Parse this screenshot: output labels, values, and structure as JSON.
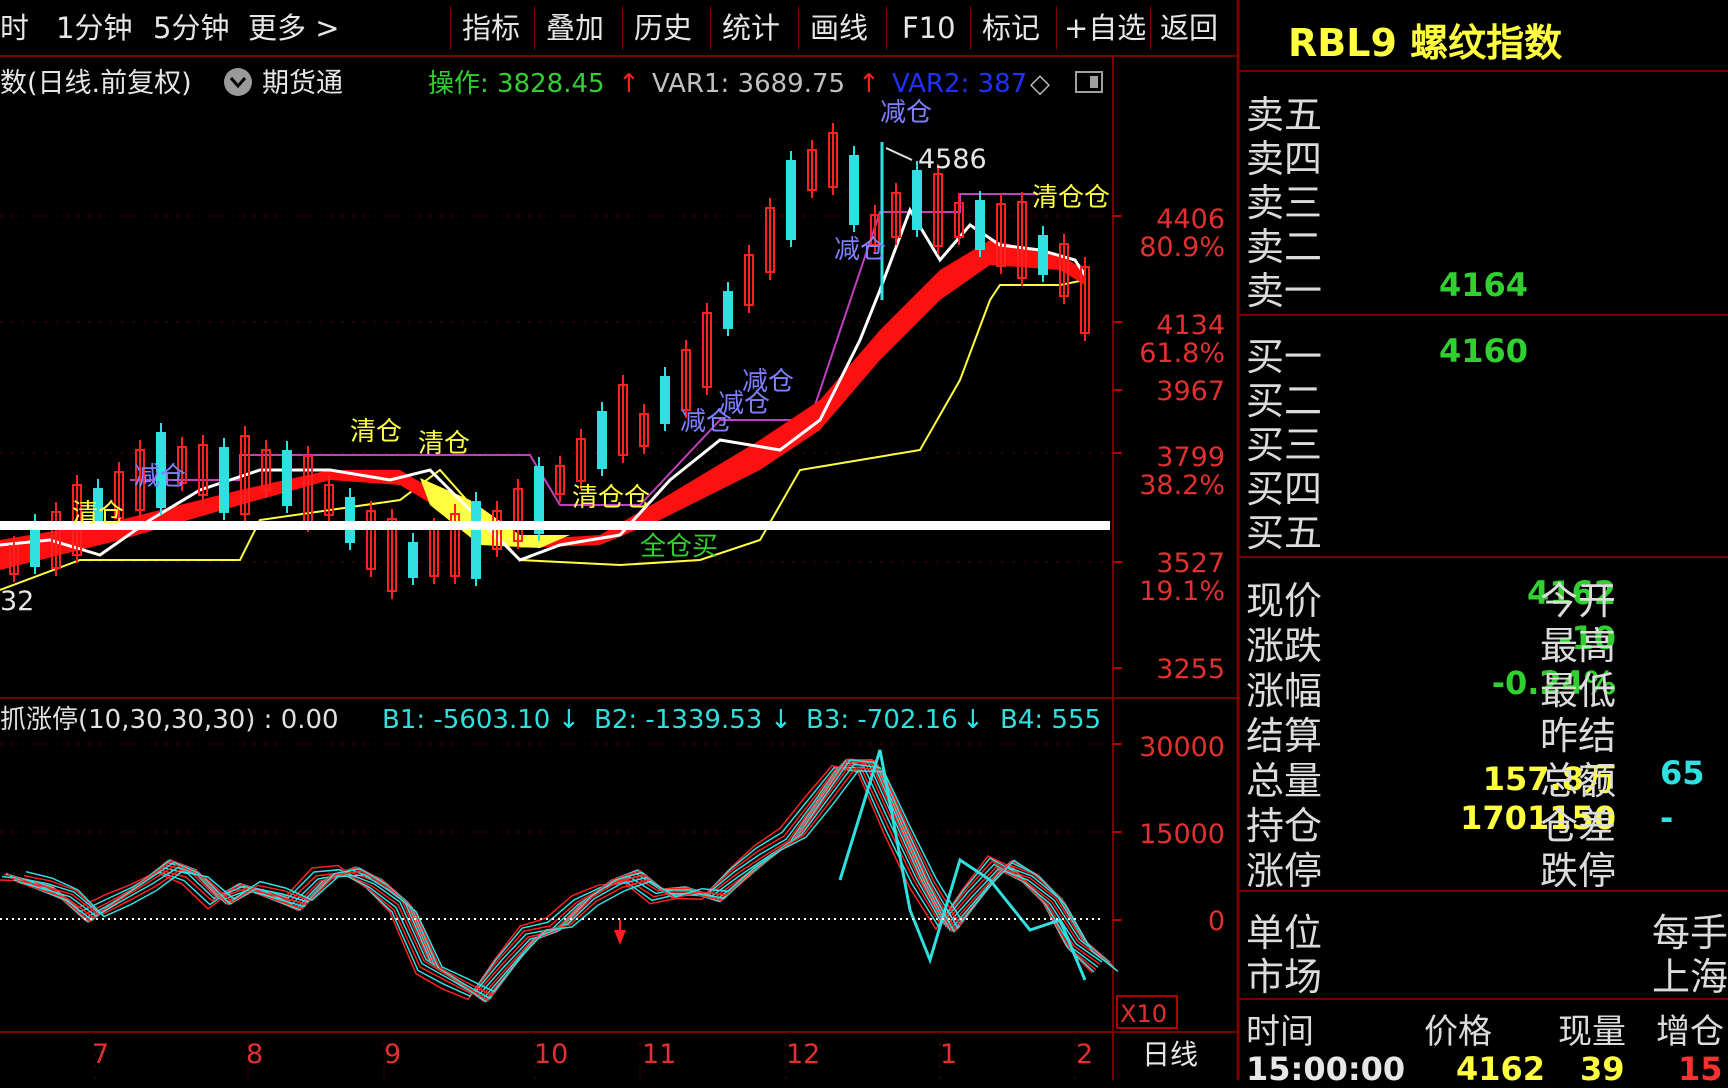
{
  "toolbar": {
    "left_items": [
      "时",
      "1分钟",
      "5分钟",
      "更多 >"
    ],
    "buttons": [
      "指标",
      "叠加",
      "历史",
      "统计",
      "画线",
      "F10",
      "标记",
      "+自选",
      "返回"
    ]
  },
  "main_header": {
    "title": "数(日线.前复权)",
    "futures_btn": "期货通",
    "op_label": "操作: 3828.45",
    "var1_label": "VAR1: 3689.75",
    "var2_label": "VAR2: 387",
    "arrow": "↑"
  },
  "price_axis": {
    "ticks": [
      "4406",
      "4134",
      "3967",
      "3799",
      "3527",
      "3255"
    ],
    "fib": [
      "80.9%",
      "61.8%",
      "38.2%",
      "19.1%"
    ]
  },
  "annotations": {
    "peak": "4586",
    "left_low": "32",
    "signals": [
      "清仓",
      "减仓",
      "清仓",
      "清仓",
      "清仓仓",
      "减仓",
      "减仓",
      "减仓",
      "减仓",
      "全仓买",
      "减仓",
      "清仓仓"
    ]
  },
  "indicator_header": {
    "title": "抓涨停(10,30,30,30) : 0.00",
    "b1": "B1: -5603.10",
    "b2": "B2: -1339.53",
    "b3": "B3: -702.16",
    "b4": "B4: 555",
    "down_arrow": "↓"
  },
  "indicator_axis": {
    "ticks": [
      "30000",
      "15000",
      "0"
    ],
    "multiplier": "X10"
  },
  "months": [
    "7",
    "8",
    "9",
    "10",
    "11",
    "12",
    "1",
    "2"
  ],
  "period_label": "日线",
  "quote": {
    "title": "RBL9 螺纹指数",
    "sells": [
      {
        "label": "卖五",
        "value": ""
      },
      {
        "label": "卖四",
        "value": ""
      },
      {
        "label": "卖三",
        "value": ""
      },
      {
        "label": "卖二",
        "value": ""
      },
      {
        "label": "卖一",
        "value": "4164"
      }
    ],
    "buys": [
      {
        "label": "买一",
        "value": "4160"
      },
      {
        "label": "买二",
        "value": ""
      },
      {
        "label": "买三",
        "value": ""
      },
      {
        "label": "买四",
        "value": ""
      },
      {
        "label": "买五",
        "value": ""
      }
    ],
    "stats": [
      {
        "label": "现价",
        "value": "4162",
        "label2": "今开",
        "value2": ""
      },
      {
        "label": "涨跌",
        "value": "-10",
        "label2": "最高",
        "value2": ""
      },
      {
        "label": "涨幅",
        "value": "-0.24%",
        "label2": "最低",
        "value2": ""
      },
      {
        "label": "结算",
        "value": "",
        "label2": "昨结",
        "value2": ""
      },
      {
        "label": "总量",
        "value": "157.8万",
        "label2": "总额",
        "value2": "65"
      },
      {
        "label": "持仓",
        "value": "1701150",
        "label2": "仓差",
        "value2": "-"
      },
      {
        "label": "涨停",
        "value": "",
        "label2": "跌停",
        "value2": ""
      }
    ],
    "unit_label": "单位",
    "unit_value": "每手",
    "market_label": "市场",
    "market_value": "上海",
    "ticks_header": [
      "时间",
      "价格",
      "现量",
      "增仓"
    ],
    "tick_row": [
      "15:00:00",
      "4162",
      "39",
      "15"
    ]
  },
  "colors": {
    "up": "#ff2020",
    "down": "#30e0e0",
    "grid": "#7a0000",
    "green": "#30d030",
    "yellow": "#ffff40",
    "blue": "#7070ff"
  }
}
